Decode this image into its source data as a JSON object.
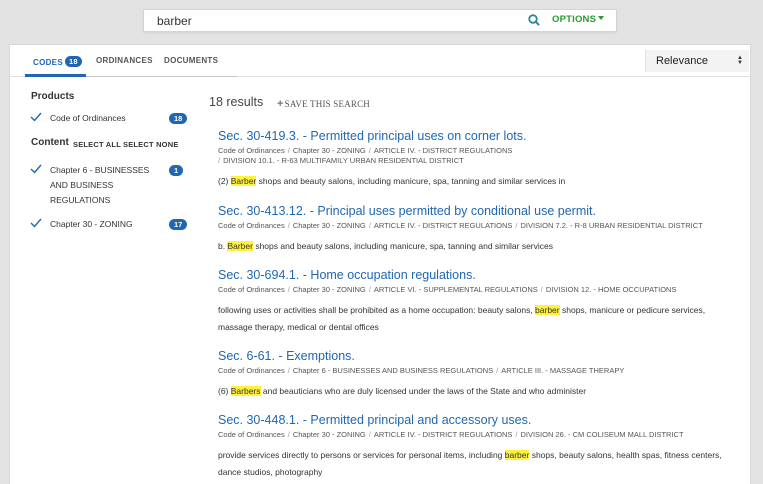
{
  "search": {
    "value": "barber",
    "options_label": "OPTIONS"
  },
  "tabs": [
    {
      "label": "CODES",
      "count": "18",
      "active": true
    },
    {
      "label": "ORDINANCES",
      "active": false
    },
    {
      "label": "DOCUMENTS",
      "active": false
    }
  ],
  "sort": {
    "selected": "Relevance"
  },
  "facets": {
    "products_heading": "Products",
    "products": [
      {
        "label": "Code of Ordinances",
        "count": "18"
      }
    ],
    "content_heading": "Content",
    "select_all": "SELECT ALL",
    "select_none": "SELECT NONE",
    "content": [
      {
        "label": "Chapter 6 - BUSINESSES AND BUSINESS REGULATIONS",
        "count": "1"
      },
      {
        "label": "Chapter 30 - ZONING",
        "count": "17"
      }
    ]
  },
  "results_summary": "18 results",
  "save_search": "SAVE THIS SEARCH",
  "results": [
    {
      "title": "Sec. 30-419.3. - Permitted principal uses on corner lots.",
      "crumbs": [
        "Code of Ordinances",
        "Chapter 30 - ZONING",
        "ARTICLE IV. - DISTRICT REGULATIONS",
        "DIVISION 10.1. - R-63 MULTIFAMILY URBAN RESIDENTIAL DISTRICT"
      ],
      "snip_pre": "(2) ",
      "snip_hl": "Barber",
      "snip_post": " shops and beauty salons, including manicure, spa, tanning and similar services in"
    },
    {
      "title": "Sec. 30-413.12. - Principal uses permitted by conditional use permit.",
      "crumbs": [
        "Code of Ordinances",
        "Chapter 30 - ZONING",
        "ARTICLE IV. - DISTRICT REGULATIONS",
        "DIVISION 7.2. - R-8 URBAN RESIDENTIAL DISTRICT"
      ],
      "snip_pre": "b. ",
      "snip_hl": "Barber",
      "snip_post": " shops and beauty salons, including manicure, spa, tanning and similar services"
    },
    {
      "title": "Sec. 30-694.1. - Home occupation regulations.",
      "crumbs": [
        "Code of Ordinances",
        "Chapter 30 - ZONING",
        "ARTICLE VI. - SUPPLEMENTAL REGULATIONS",
        "DIVISION 12. - HOME OCCUPATIONS"
      ],
      "snip_pre": "following uses or activities shall be prohibited as a home occupation: beauty salons, ",
      "snip_hl": "barber",
      "snip_post": " shops, manicure or pedicure services, massage therapy, medical or dental offices"
    },
    {
      "title": "Sec. 6-61. - Exemptions.",
      "crumbs": [
        "Code of Ordinances",
        "Chapter 6 - BUSINESSES AND BUSINESS REGULATIONS",
        "ARTICLE III. - MASSAGE THERAPY"
      ],
      "snip_pre": "(6) ",
      "snip_hl": "Barbers",
      "snip_post": " and beauticians who are duly licensed under the laws of the State and who administer"
    },
    {
      "title": "Sec. 30-448.1. - Permitted principal and accessory uses.",
      "crumbs": [
        "Code of Ordinances",
        "Chapter 30 - ZONING",
        "ARTICLE IV. - DISTRICT REGULATIONS",
        "DIVISION 26. - CM COLISEUM MALL DISTRICT"
      ],
      "snip_pre": "provide services directly to persons or services for personal items, including ",
      "snip_hl": "barber",
      "snip_post": " shops, beauty salons, health spas, fitness centers, dance studios, photography"
    }
  ]
}
